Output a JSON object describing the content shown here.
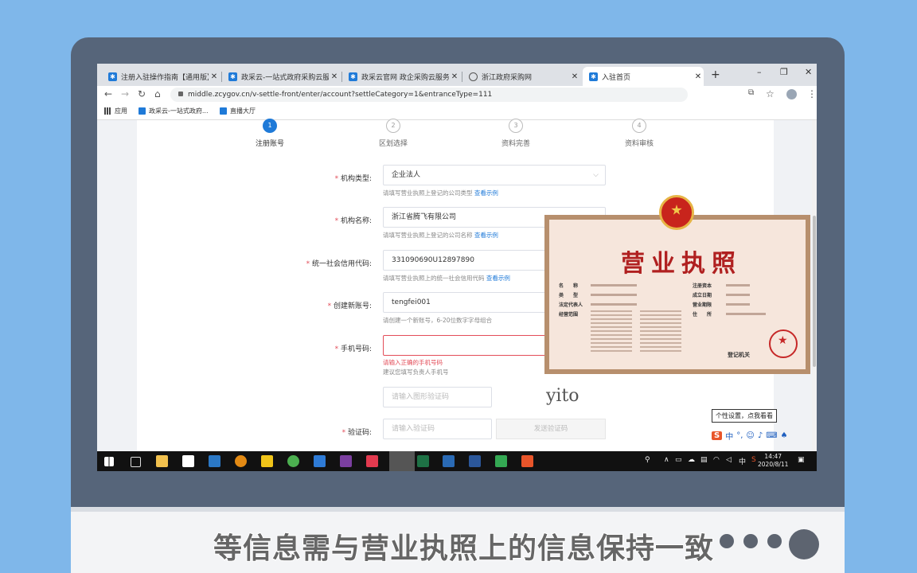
{
  "browser": {
    "tabs": [
      {
        "label": "注册入驻操作指南【通用版】-"
      },
      {
        "label": "政采云-一站式政府采购云服务"
      },
      {
        "label": "政采云官网 政企采购云服务平"
      },
      {
        "label": "浙江政府采购网"
      },
      {
        "label": "入驻首页"
      }
    ],
    "new_tab": "+",
    "window_controls": [
      "–",
      "❐",
      "✕"
    ],
    "url": "middle.zcygov.cn/v-settle-front/enter/account?settleCategory=1&entranceType=111",
    "bookmarks": [
      "应用",
      "政采云-一站式政府...",
      "直播大厅"
    ]
  },
  "steps": [
    {
      "num": "1",
      "label": "注册账号"
    },
    {
      "num": "2",
      "label": "区划选择"
    },
    {
      "num": "3",
      "label": "资料完善"
    },
    {
      "num": "4",
      "label": "资料审核"
    }
  ],
  "form": {
    "org_type": {
      "label": "机构类型:",
      "value": "企业法人",
      "hint": "请填写营业执照上登记的公司类型",
      "link": "查看示例"
    },
    "org_name": {
      "label": "机构名称:",
      "value": "浙江省腾飞有限公司",
      "hint": "请填写营业执照上登记的公司名称",
      "link": "查看示例"
    },
    "credit_code": {
      "label": "统一社会信用代码:",
      "value": "331090690U12897890",
      "hint": "请填写营业执照上的统一社会信用代码",
      "link": "查看示例"
    },
    "account": {
      "label": "创建新账号:",
      "value": "tengfei001",
      "hint": "请创建一个新账号，6-20位数字字母组合"
    },
    "phone": {
      "label": "手机号码:",
      "value": "",
      "error": "请输入正确的手机号码",
      "hint": "建议您填写负责人手机号"
    },
    "captcha_img": {
      "placeholder": "请输入图形验证码"
    },
    "sms_code": {
      "label": "验证码:",
      "placeholder": "请输入验证码",
      "send_label": "发送验证码"
    }
  },
  "license": {
    "title": "营业执照",
    "fields_left": [
      "名　　称",
      "类　　型",
      "法定代表人",
      "经营范围"
    ],
    "fields_right": [
      "注册资本",
      "成立日期",
      "营业期限",
      "住　　所"
    ],
    "issuer": "登记机关"
  },
  "watermark": "yito",
  "ime": {
    "tooltip": "个性设置，点我看看",
    "mode": "中"
  },
  "clock": {
    "time": "14:47",
    "date": "2020/8/11"
  },
  "subtitle": "等信息需与营业执照上的信息保持一致",
  "colors": {
    "accent": "#1f7ad8",
    "error": "#e34d59",
    "background": "#7fb7ea"
  }
}
